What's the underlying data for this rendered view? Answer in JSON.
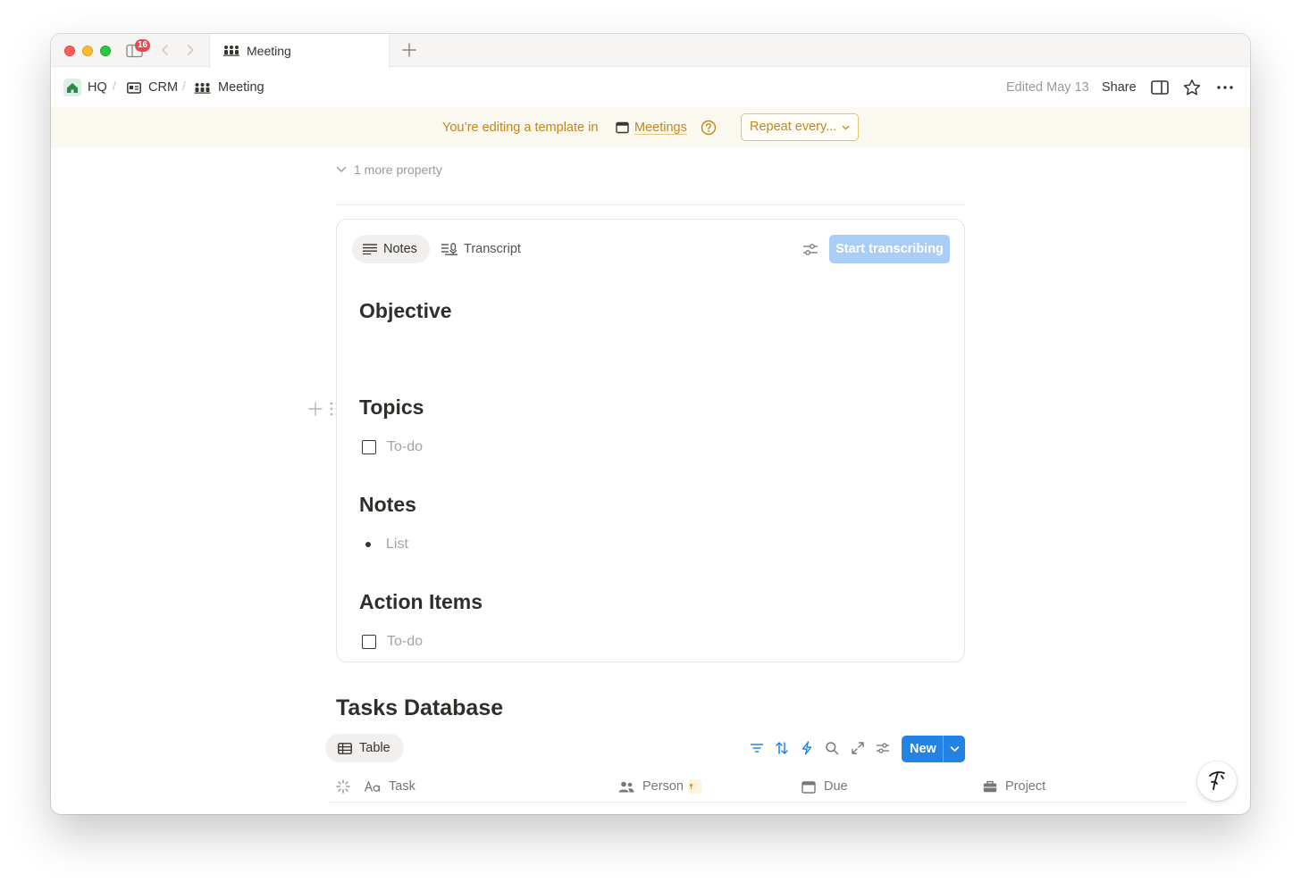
{
  "titlebar": {
    "notification_count": "16",
    "tab_title": "Meeting"
  },
  "breadcrumb": {
    "items": [
      {
        "label": "HQ",
        "icon": "home-icon"
      },
      {
        "label": "CRM",
        "icon": "contact-card-icon"
      },
      {
        "label": "Meeting",
        "icon": "people-icon"
      }
    ],
    "separator": "/"
  },
  "topbar": {
    "edited": "Edited May 13",
    "share_label": "Share"
  },
  "banner": {
    "text": "You’re editing a template in",
    "database_link": "Meetings",
    "repeat_label": "Repeat every..."
  },
  "properties": {
    "more_label": "1 more property"
  },
  "meeting_block": {
    "tabs": [
      {
        "label": "Notes",
        "active": true
      },
      {
        "label": "Transcript",
        "active": false
      }
    ],
    "start_label": "Start transcribing",
    "sections": [
      {
        "heading": "Objective"
      },
      {
        "heading": "Topics",
        "item": "To-do",
        "item_type": "todo"
      },
      {
        "heading": "Notes",
        "item": "List",
        "item_type": "bullet"
      },
      {
        "heading": "Action Items",
        "item": "To-do",
        "item_type": "todo"
      }
    ]
  },
  "tasks_db": {
    "title": "Tasks Database",
    "view_label": "Table",
    "new_label": "New",
    "columns": [
      {
        "label": "Task",
        "icon": "title-aa-icon"
      },
      {
        "label": "Person",
        "icon": "people-icon"
      },
      {
        "label": "Due",
        "icon": "calendar-icon"
      },
      {
        "label": "Project",
        "icon": "briefcase-icon"
      }
    ]
  },
  "colors": {
    "accent_blue": "#2383e2",
    "banner_text": "#c0881b",
    "banner_bg": "#fbf8ef"
  }
}
